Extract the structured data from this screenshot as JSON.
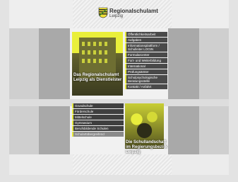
{
  "header": {
    "title": "Regionalschulamt",
    "subtitle": "Leipzig",
    "logo_icon": "saxony-coat-of-arms-icon"
  },
  "panel_top_left": {
    "caption": "Das Regionalschulamt Leipzig als Dienstleister"
  },
  "menu_top_right": {
    "items": [
      {
        "label": "Öffentlichkeitsarbeit"
      },
      {
        "label": "Aufgaben"
      },
      {
        "label": "Informationsplattform / Schulleiter LOGIN"
      },
      {
        "label": "Formularcenter"
      },
      {
        "label": "Fort- und Weiterbildung"
      },
      {
        "label": "International"
      },
      {
        "label": "Prüfungsämter"
      },
      {
        "label": "Schulpsychologische Beratungsstelle"
      },
      {
        "label": "Kontakt / Anfahrt"
      }
    ]
  },
  "menu_bottom_left": {
    "items": [
      {
        "label": "Grundschule"
      },
      {
        "label": "Förderschule"
      },
      {
        "label": "Mittelschule"
      },
      {
        "label": "Gymnasium"
      },
      {
        "label": "Berufsbildende Schulen"
      },
      {
        "label": "Schulartübergreifend"
      }
    ]
  },
  "panel_bottom_right": {
    "caption": "Die Schullandschaft im Regierungsbezirk Leipzig"
  },
  "colors": {
    "accent": "#e5e838",
    "menu_bg": "#4a4a4a"
  }
}
